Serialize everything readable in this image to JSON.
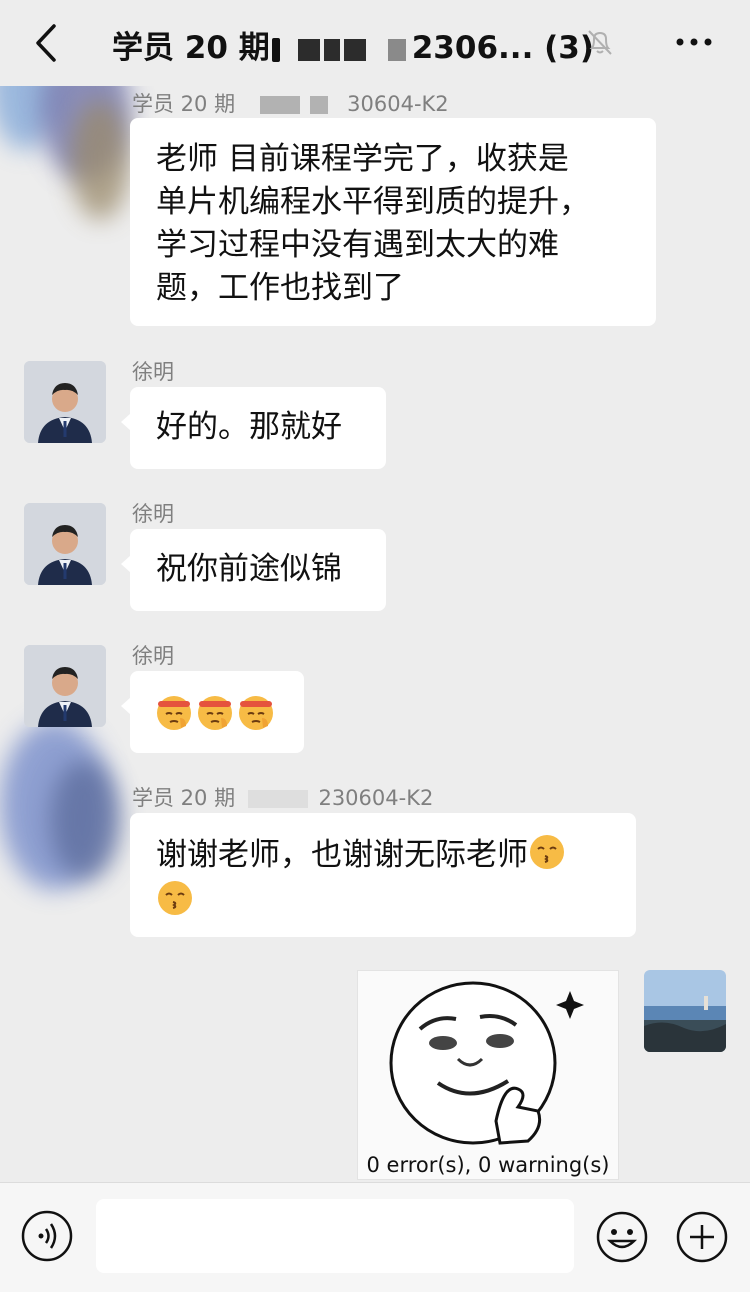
{
  "header": {
    "title_prefix": "学员 20 期",
    "title_suffix": "2306... (3)",
    "icons": [
      "back-chevron-icon",
      "muted-bell-icon",
      "more-dots-icon"
    ]
  },
  "messages": [
    {
      "sender_prefix": "学员 20 期",
      "sender_suffix": "30604-K2",
      "text": "老师 目前课程学完了，收获是\n单片机编程水平得到质的提升，\n学习过程中没有遇到太大的难\n题，工作也找到了"
    },
    {
      "sender": "徐明",
      "text": "好的。那就好"
    },
    {
      "sender": "徐明",
      "text": "祝你前途似锦"
    },
    {
      "sender": "徐明",
      "emoji": "saluting-face-emoji x3"
    },
    {
      "sender_prefix": "学员 20 期",
      "sender_suffix": "230604-K2",
      "text": "谢谢老师，也谢谢无际老师"
    },
    {
      "sticker_caption": "0 error(s), 0 warning(s)"
    }
  ],
  "input_bar": {
    "placeholder": "",
    "icons": [
      "voice-icon",
      "emoji-icon",
      "plus-icon"
    ]
  }
}
